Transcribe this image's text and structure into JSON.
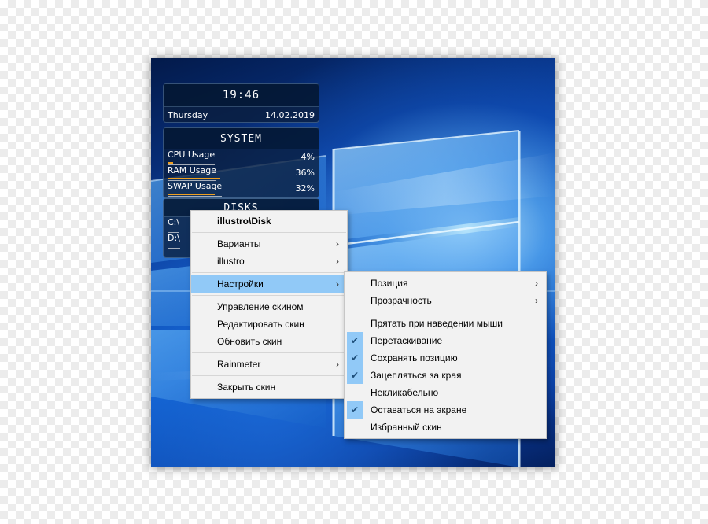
{
  "widgets": {
    "clock": {
      "time": "19:46",
      "day": "Thursday",
      "date": "14.02.2019"
    },
    "system": {
      "title": "SYSTEM",
      "rows": [
        {
          "label": "CPU Usage",
          "value": "4%",
          "level": 0.04
        },
        {
          "label": "RAM Usage",
          "value": "36%",
          "level": 0.36
        },
        {
          "label": "SWAP Usage",
          "value": "32%",
          "level": 0.32
        }
      ]
    },
    "disks": {
      "title": "DISKS",
      "rows": [
        {
          "label": "C:\\"
        },
        {
          "label": "D:\\"
        }
      ]
    }
  },
  "context_menu": {
    "title": "illustro\\Disk",
    "items": {
      "variants": "Варианты",
      "illustro": "illustro",
      "settings": "Настройки",
      "manage_skin": "Управление скином",
      "edit_skin": "Редактировать скин",
      "refresh_skin": "Обновить скин",
      "rainmeter": "Rainmeter",
      "close_skin": "Закрыть скин"
    }
  },
  "settings_submenu": {
    "position": "Позиция",
    "transparency": "Прозрачность",
    "hide_on_hover": "Прятать при наведении мыши",
    "draggable": "Перетаскивание",
    "save_position": "Сохранять позицию",
    "snap_to_edges": "Зацепляться за края",
    "click_through": "Некликабельно",
    "keep_on_screen": "Оставаться на экране",
    "favorite_skin": "Избранный скин"
  },
  "icons": {
    "submenu_arrow": "chevron-right-icon",
    "check": "check-icon"
  },
  "colors": {
    "highlight": "#91c9f7",
    "menu_bg": "#f2f2f2",
    "usage_bar": "#f0a020"
  }
}
